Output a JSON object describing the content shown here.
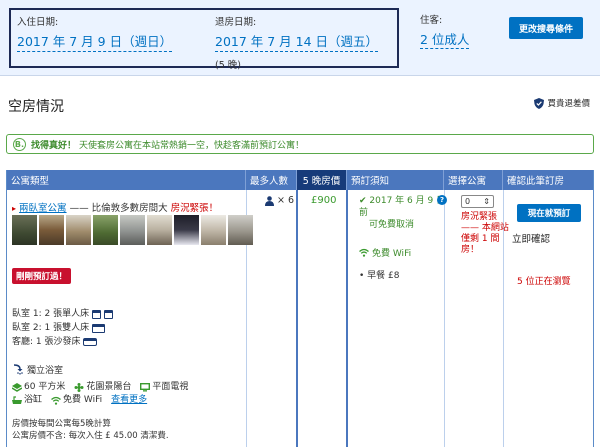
{
  "search": {
    "checkin_label": "入住日期:",
    "checkin_value": "2017 年 7 月 9 日（週日）",
    "checkout_label": "退房日期:",
    "checkout_value": "2017 年 7 月 14 日（週五）",
    "nights": "(5 晚)",
    "guests_label": "住客:",
    "guests_value": "2 位成人",
    "change_button": "更改搜尋條件"
  },
  "availability": {
    "title": "空房情況",
    "price_guarantee": "買貴退差價"
  },
  "notice": {
    "badge": "B.",
    "good": "找得真好！",
    "message": "天使套房公寓在本站常熱銷一空，快趁客滿前預訂公寓！"
  },
  "table": {
    "headers": {
      "type": "公寓類型",
      "max": "最多人數",
      "price": "5 晚房價",
      "conditions": "預訂須知",
      "select": "選擇公寓",
      "confirm": "確認此筆訂房"
    },
    "room": {
      "name": "兩臥室公寓",
      "desc": "—— 比倫敦多數房間大",
      "hot": "房況緊張！",
      "recent_badge": "剛剛預訂過！",
      "beds": [
        {
          "text": "臥室 1: 2 張單人床",
          "icon": "single-bed-icon"
        },
        {
          "text": "臥室 2: 1 張雙人床",
          "icon": "double-bed-icon"
        },
        {
          "text": "客廳: 1 張沙發床",
          "icon": "sofa-bed-icon"
        }
      ],
      "bathroom": "獨立浴室",
      "area": "60 平方米",
      "garden": "花園景陽台",
      "tv": "平面電視",
      "bath": "浴缸",
      "wifi": "免費 WiFi",
      "more": "查看更多",
      "pricing_note_1": "房價按每間公寓每5晚計算",
      "pricing_note_2": "公寓房價不含: 每次入住 £ 45.00 清潔費.",
      "max_persons": "× 6",
      "price": "£900",
      "conditions": {
        "date_text": "2017 年 6 月 9 日前",
        "free_cancel": "可免費取消",
        "wifi": "免費 WiFi",
        "breakfast": "早餐 £8"
      },
      "qty_value": "0",
      "scarcity": "房況緊張 —— 本網站僅剩 1 間房！",
      "book_button": "現在就預訂",
      "instant_confirm": "立即確認",
      "viewing": "5 位正在瀏覽"
    }
  }
}
